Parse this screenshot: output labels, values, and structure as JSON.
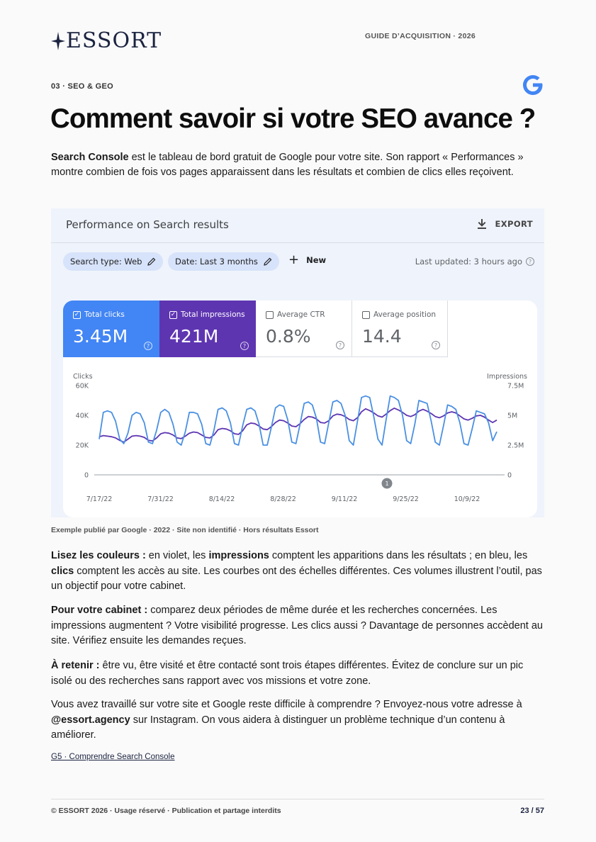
{
  "header": {
    "brand": "ESSORT",
    "guide": "GUIDE D’ACQUISITION · 2026"
  },
  "section_label": "03 · SEO & GEO",
  "title": "Comment savoir si votre SEO avance ?",
  "intro": {
    "bold": "Search Console",
    "rest": " est le tableau de bord gratuit de Google pour votre site. Son rapport « Performances » montre combien de fois vos pages apparaissent dans les résultats et combien de clics elles reçoivent."
  },
  "gsc": {
    "title": "Performance on Search results",
    "export_label": "EXPORT",
    "chip_search_type": "Search type: Web",
    "chip_date": "Date: Last 3 months",
    "new_label": "New",
    "last_updated": "Last updated: 3 hours ago",
    "metrics": [
      {
        "label": "Total clicks",
        "value": "3.45M",
        "checked": true
      },
      {
        "label": "Total impressions",
        "value": "421M",
        "checked": true
      },
      {
        "label": "Average CTR",
        "value": "0.8%",
        "checked": false
      },
      {
        "label": "Average position",
        "value": "14.4",
        "checked": false
      }
    ],
    "annotation_marker": "1"
  },
  "chart_data": {
    "type": "line",
    "left_axis_label": "Clicks",
    "right_axis_label": "Impressions",
    "left_ticks": [
      "60K",
      "40K",
      "20K",
      "0"
    ],
    "right_ticks": [
      "7.5M",
      "5M",
      "2.5M",
      "0"
    ],
    "left_range": [
      0,
      60000
    ],
    "right_range": [
      0,
      7500000
    ],
    "x_tick_labels": [
      "7/17/22",
      "7/31/22",
      "8/14/22",
      "8/28/22",
      "9/11/22",
      "9/25/22",
      "10/9/22"
    ],
    "colors": {
      "clicks": "#4a90e2",
      "impressions": "#5e35b1"
    },
    "series": [
      {
        "name": "Clicks",
        "axis": "left",
        "values": [
          24000,
          42000,
          43000,
          42000,
          36000,
          24000,
          21000,
          28000,
          40000,
          42000,
          41000,
          35000,
          22000,
          21000,
          30000,
          42000,
          44000,
          42000,
          34000,
          22000,
          20000,
          29000,
          42000,
          42000,
          41000,
          34000,
          21000,
          20000,
          30000,
          44000,
          45000,
          43000,
          35000,
          21000,
          20000,
          33000,
          44000,
          45000,
          43000,
          34000,
          20000,
          20000,
          32000,
          45000,
          47000,
          46000,
          37000,
          22000,
          21000,
          34000,
          48000,
          49000,
          47000,
          38000,
          22000,
          21000,
          35000,
          49000,
          50000,
          48000,
          40000,
          23000,
          20000,
          36000,
          52000,
          53000,
          52000,
          39000,
          24000,
          20000,
          37000,
          53000,
          52000,
          50000,
          40000,
          23000,
          21000,
          34000,
          50000,
          49000,
          48000,
          36000,
          22000,
          20000,
          33000,
          47000,
          46000,
          44000,
          35000,
          21000,
          20000,
          31000,
          43000,
          42000,
          41000,
          35000,
          23000,
          29000
        ],
        "note": "daily values read from chart, 7/11/22 to 10/16/22"
      },
      {
        "name": "Impressions",
        "axis": "right",
        "values": [
          3200000,
          3300000,
          3250000,
          3200000,
          3100000,
          2900000,
          2750000,
          3000000,
          3250000,
          3300000,
          3250000,
          3150000,
          2900000,
          2850000,
          3100000,
          3450000,
          3550000,
          3500000,
          3350000,
          3100000,
          3050000,
          3250000,
          3500000,
          3600000,
          3550000,
          3350000,
          3150000,
          3100000,
          3350000,
          3800000,
          3900000,
          3850000,
          3700000,
          3450000,
          3400000,
          3700000,
          4200000,
          4350000,
          4300000,
          4100000,
          3850000,
          3800000,
          4050000,
          4400000,
          4600000,
          4550000,
          4350000,
          4100000,
          4050000,
          4300000,
          4650000,
          4900000,
          4850000,
          4700000,
          4400000,
          4350000,
          4550000,
          4950000,
          5100000,
          5050000,
          4900000,
          4650000,
          4550000,
          4800000,
          5300000,
          5550000,
          5400000,
          5200000,
          4950000,
          4850000,
          5100000,
          5400000,
          5600000,
          5450000,
          5250000,
          5000000,
          4900000,
          5050000,
          5350000,
          5500000,
          5350000,
          5150000,
          4900000,
          4800000,
          4950000,
          5200000,
          5300000,
          5200000,
          4950000,
          4700000,
          4600000,
          4750000,
          4950000,
          5000000,
          4850000,
          4600000,
          4400000,
          4600000
        ]
      }
    ],
    "grid": true,
    "legend": "none"
  },
  "caption": "Exemple publié par Google · 2022 · Site non identifié · Hors résultats Essort",
  "paragraphs": {
    "p1": {
      "b1": "Lisez les couleurs :",
      "t1": " en violet, les ",
      "b2": "impressions",
      "t2": " comptent les apparitions dans les résultats ; en bleu, les ",
      "b3": "clics",
      "t3": " comptent les accès au site. Les courbes ont des échelles différentes. Ces volumes illustrent l’outil, pas un objectif pour votre cabinet."
    },
    "p2": {
      "b1": "Pour votre cabinet :",
      "t1": " comparez deux périodes de même durée et les recherches concernées. Les impressions augmentent ? Votre visibilité progresse. Les clics aussi ? Davantage de personnes accèdent au site. Vérifiez ensuite les demandes reçues."
    },
    "p3": {
      "b1": "À retenir :",
      "t1": " être vu, être visité et être contacté sont trois étapes différentes. Évitez de conclure sur un pic isolé ou des recherches sans rapport avec vos missions et votre zone."
    },
    "p4": {
      "t1": "Vous avez travaillé sur votre site et Google reste difficile à comprendre ? Envoyez-nous votre adresse à ",
      "b1": "@essort.agency",
      "t2": " sur Instagram. On vous aidera à distinguer un problème technique d’un contenu à améliorer."
    }
  },
  "link": "G5 · Comprendre Search Console",
  "footer": {
    "left": "© ESSORT 2026 · Usage réservé · Publication et partage interdits",
    "right": "23 / 57"
  }
}
